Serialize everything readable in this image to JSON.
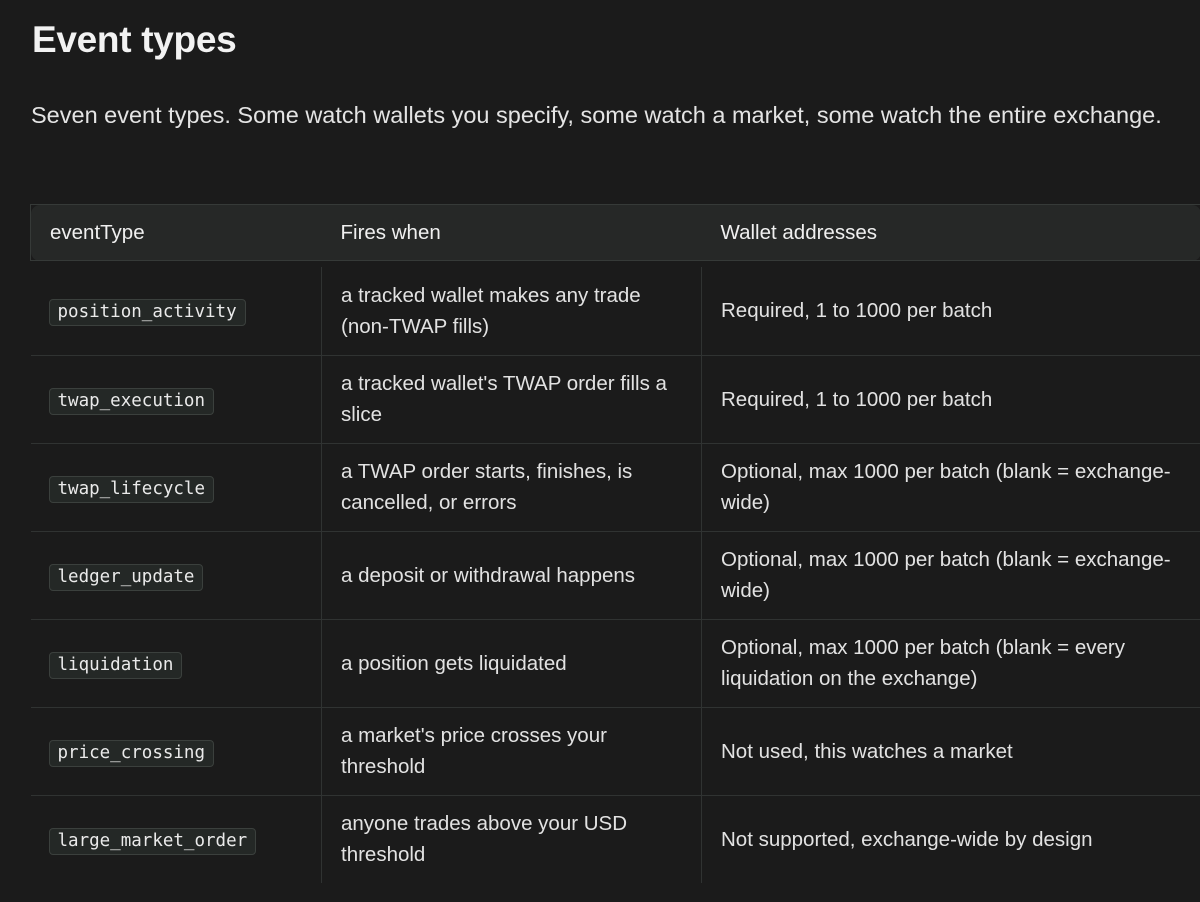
{
  "page": {
    "title": "Event types",
    "intro": "Seven event types. Some watch wallets you specify, some watch a market, some watch the entire exchange."
  },
  "table": {
    "headers": [
      "eventType",
      "Fires when",
      "Wallet addresses"
    ],
    "rows": [
      {
        "event_type": "position_activity",
        "fires_when": "a tracked wallet makes any trade (non-TWAP fills)",
        "wallet_addresses": "Required, 1 to 1000 per batch"
      },
      {
        "event_type": "twap_execution",
        "fires_when": "a tracked wallet's TWAP order fills a slice",
        "wallet_addresses": "Required, 1 to 1000 per batch"
      },
      {
        "event_type": "twap_lifecycle",
        "fires_when": "a TWAP order starts, finishes, is cancelled, or errors",
        "wallet_addresses": "Optional, max 1000 per batch (blank = exchange-wide)"
      },
      {
        "event_type": "ledger_update",
        "fires_when": "a deposit or withdrawal happens",
        "wallet_addresses": "Optional, max 1000 per batch (blank = exchange-wide)"
      },
      {
        "event_type": "liquidation",
        "fires_when": "a position gets liquidated",
        "wallet_addresses": "Optional, max 1000 per batch (blank = every liquidation on the exchange)"
      },
      {
        "event_type": "price_crossing",
        "fires_when": "a market's price crosses your threshold",
        "wallet_addresses": "Not used, this watches a market"
      },
      {
        "event_type": "large_market_order",
        "fires_when": "anyone trades above your USD threshold",
        "wallet_addresses": "Not supported, exchange-wide by design"
      }
    ]
  },
  "colors": {
    "background": "#1b1b1b",
    "header_background": "#262827",
    "code_background": "#242826",
    "text": "#e6e6e6"
  }
}
